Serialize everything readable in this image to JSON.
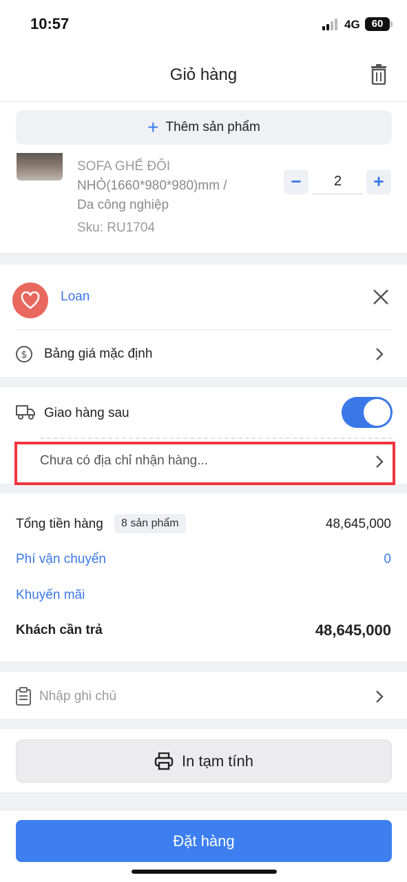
{
  "status_bar": {
    "time": "10:57",
    "network": "4G",
    "battery": "60"
  },
  "header": {
    "title": "Giỏ hàng",
    "trash_icon": "trash-icon"
  },
  "add_product": {
    "label": "Thêm sản phẩm",
    "icon": "plus-icon"
  },
  "product": {
    "name_line1": "SOFA GHẾ ĐÔI",
    "name_line2": "NHỎ(1660*980*980)mm /",
    "name_line3": "Da công nghiệp",
    "sku": "Sku: RU1704",
    "quantity": "2",
    "minus_label": "−",
    "plus_label": "+"
  },
  "customer": {
    "name": "Loan",
    "avatar_icon": "heart-icon",
    "price_list": "Bảng giá mặc định"
  },
  "delivery": {
    "label": "Giao hàng sau",
    "toggle_on": true,
    "address_placeholder": "Chưa có địa chỉ nhận hàng..."
  },
  "totals": {
    "subtotal_label": "Tổng tiền hàng",
    "item_count_badge": "8 sản phẩm",
    "subtotal_value": "48,645,000",
    "shipping_label": "Phí vận chuyển",
    "shipping_value": "0",
    "promotion_label": "Khuyến mãi",
    "payable_label": "Khách cần trả",
    "payable_value": "48,645,000"
  },
  "note": {
    "placeholder": "Nhập ghi chú"
  },
  "print": {
    "label": "In tạm tính"
  },
  "order": {
    "label": "Đặt hàng"
  },
  "colors": {
    "accent": "#3a78e8",
    "highlight": "#f2343e",
    "avatar": "#e8685e"
  }
}
